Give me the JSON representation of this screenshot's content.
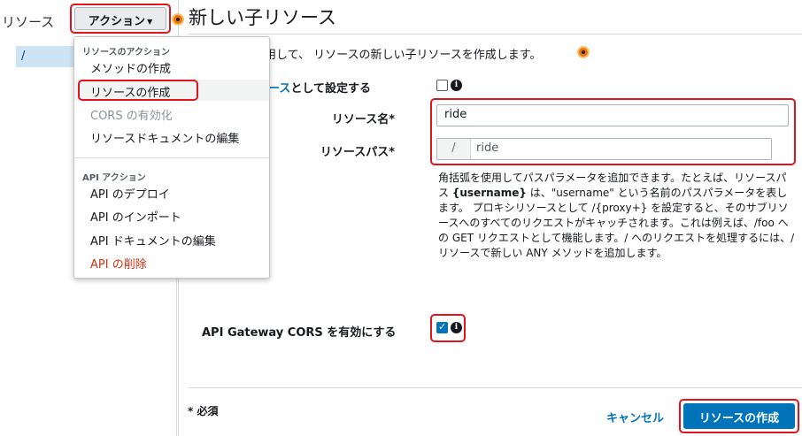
{
  "left": {
    "title": "リソース",
    "root_path": "/"
  },
  "action_button": {
    "label": "アクション",
    "caret": "▼"
  },
  "header": {
    "title": "新しい子リソース"
  },
  "intro": "使用して、 リソースの新しい子リソースを作成します。",
  "menu": {
    "resource_heading": "リソースのアクション",
    "resource_items": [
      {
        "label": "メソッドの作成"
      },
      {
        "label": "リソースの作成"
      },
      {
        "label": "CORS の有効化"
      },
      {
        "label": "リソースドキュメントの編集"
      }
    ],
    "api_heading": "API アクション",
    "api_items": [
      {
        "label": "API のデプロイ"
      },
      {
        "label": "API のインポート"
      },
      {
        "label": "API ドキュメントの編集"
      },
      {
        "label": "API の削除"
      }
    ]
  },
  "form": {
    "proxy_label_link": "ソース",
    "proxy_label_rest": "として設定する",
    "resource_name_label": "リソース名*",
    "resource_name_value": "ride",
    "resource_path_label": "リソースパス*",
    "resource_path_prefix": "/",
    "resource_path_value": "ride",
    "help_text_1": "角括弧を使用してパスパラメータを追加できます。たとえば、リソースパス ",
    "help_text_bold": "{username}",
    "help_text_2": " は、\"username\" という名前のパスパラメータを表します。 プロキシリソースとして /{proxy+} を設定すると、そのサブリソースへのすべてのリクエストがキャッチされます。これは例えば、/foo への GET リクエストとして機能します。/ へのリクエストを処理するには、/ リソースで新しい ANY メソッドを追加します。",
    "cors_label": "API Gateway CORS を有効にする",
    "info_glyph": "i"
  },
  "footer": {
    "required": "* 必須",
    "cancel": "キャンセル",
    "create": "リソースの作成"
  }
}
